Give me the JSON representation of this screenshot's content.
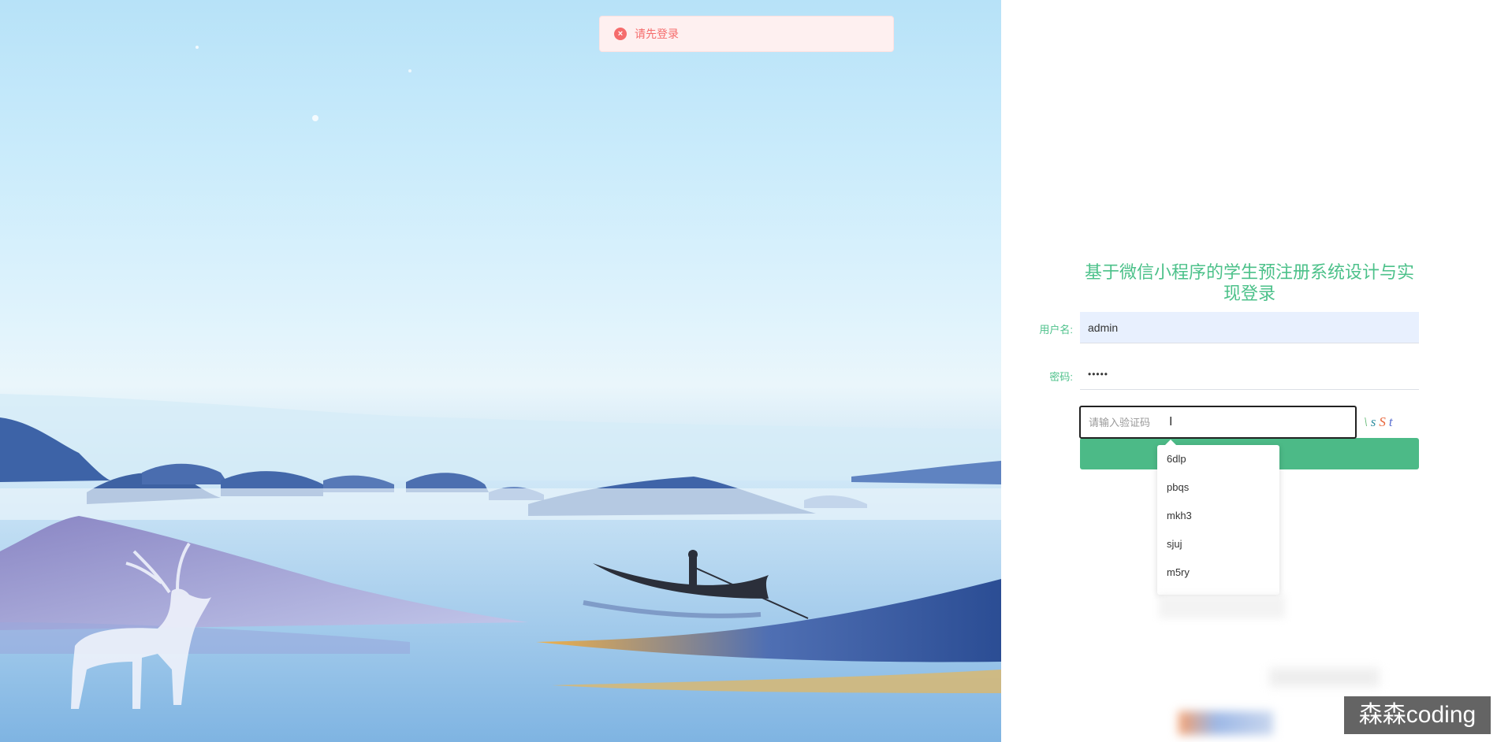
{
  "toast": {
    "message": "请先登录",
    "icon": "close-circle-icon",
    "color": "#f56c6c"
  },
  "login": {
    "title": "基于微信小程序的学生预注册系统设计与实现登录",
    "username_label": "用户名:",
    "username_value": "admin",
    "password_label": "密码:",
    "password_value": "•••••",
    "captcha_placeholder": "请输入验证码",
    "captcha_chars": [
      "\\",
      "s",
      "S",
      "t"
    ],
    "accent_color": "#4cc18a"
  },
  "autocomplete": {
    "items": [
      "6dlp",
      "pbqs",
      "mkh3",
      "sjuj",
      "m5ry"
    ]
  },
  "watermark": {
    "text": "森森coding"
  }
}
